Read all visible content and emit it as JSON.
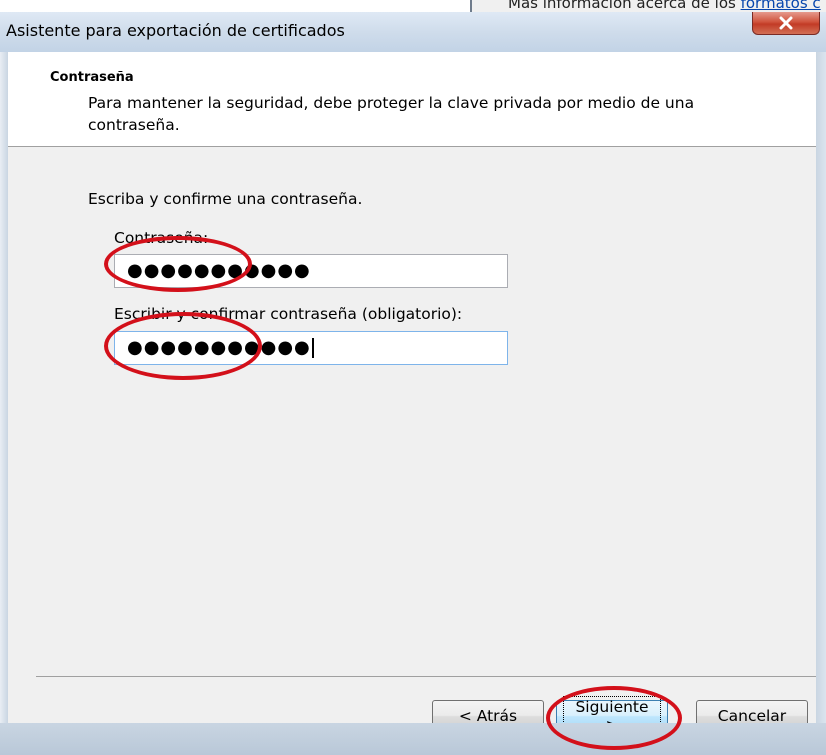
{
  "background": {
    "partial_text": "Más información acerca de los",
    "partial_link": "formatos c"
  },
  "window": {
    "title": "Asistente para exportación de certificados",
    "close_label": "x"
  },
  "header": {
    "title": "Contraseña",
    "description": "Para mantener la seguridad, debe proteger la clave privada por medio de una contraseña."
  },
  "form": {
    "prompt": "Escriba y confirme una contraseña.",
    "password_label": "Contraseña:",
    "password_value": "●●●●●●●●●●●",
    "confirm_label": "Escribir y confirmar contraseña (obligatorio):",
    "confirm_value": "●●●●●●●●●●●"
  },
  "buttons": {
    "back": "< Atrás",
    "next": "Siguiente >",
    "cancel": "Cancelar"
  },
  "colors": {
    "highlight": "#d3101a",
    "dialog_bg": "#f0f0f0",
    "titlebar": "#cfdceb"
  }
}
